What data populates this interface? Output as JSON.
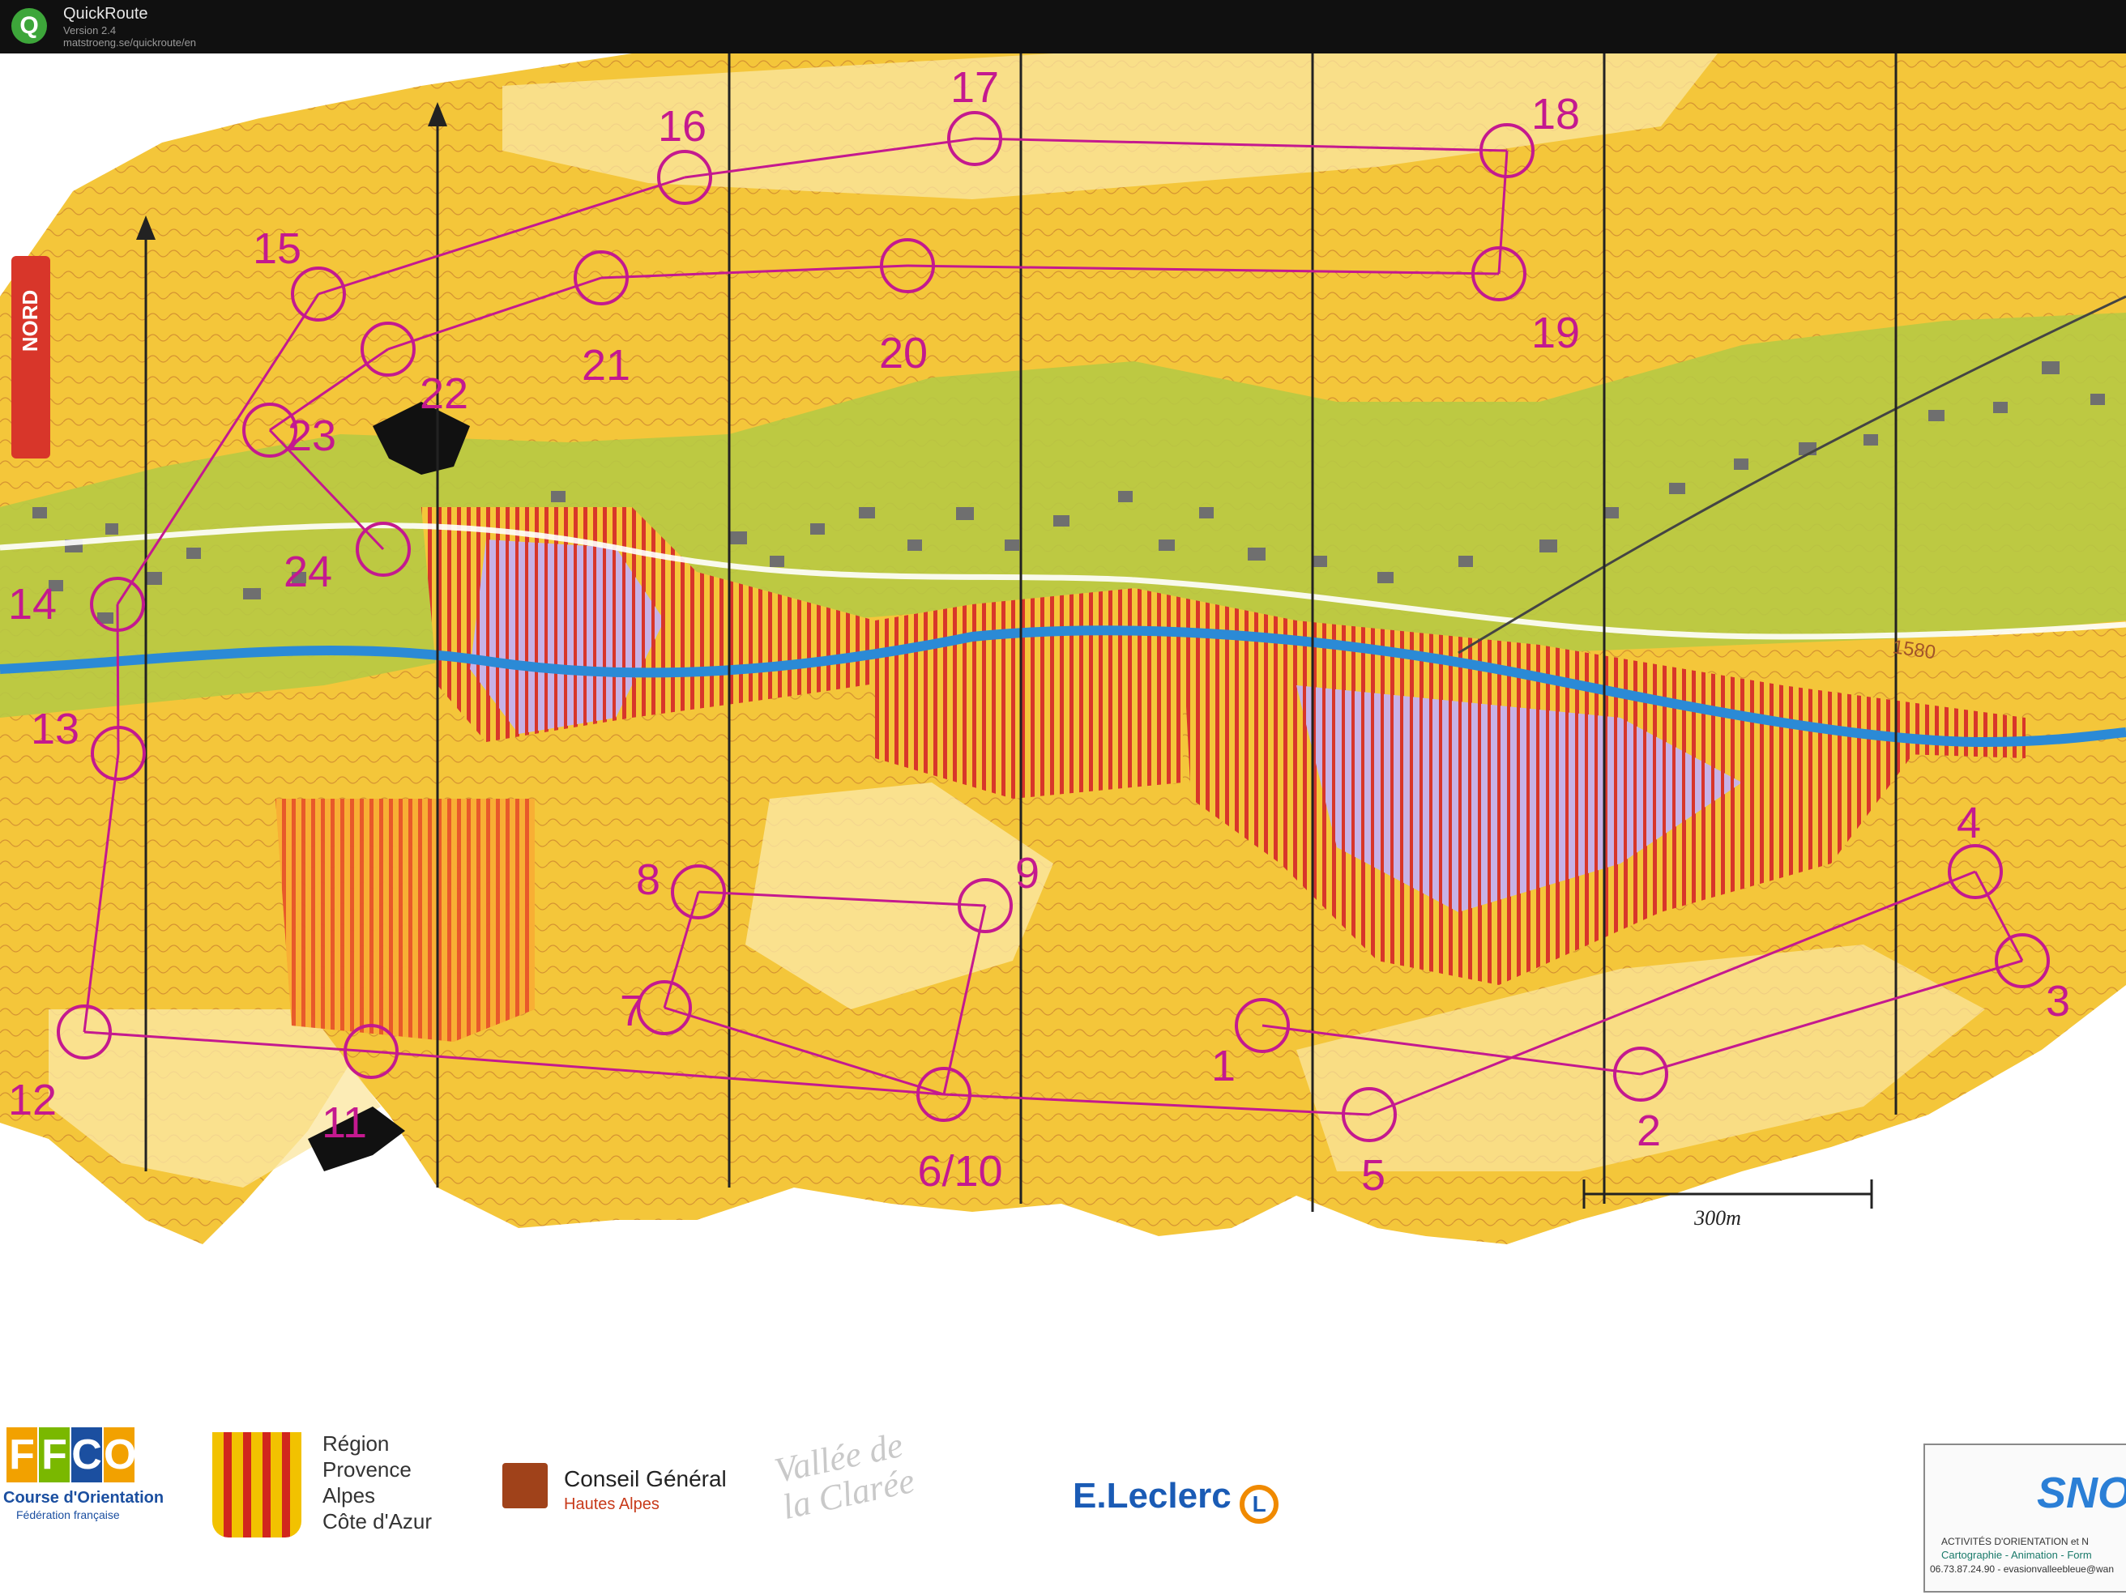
{
  "window": {
    "app_name": "QuickRoute",
    "app_icon": "Q",
    "version": "Version 2.4",
    "url": "matstroeng.se/quickroute/en"
  },
  "map": {
    "scale_label": "300m",
    "elevation_label": "1580",
    "north_label": "NORD",
    "colors": {
      "course": "#c4198f",
      "terrain_open": "#f4c63a",
      "terrain_light": "#fbe7a4",
      "forest_green": "#b7c944",
      "river": "#2b8ad6",
      "out_of_bounds": "#d8362a",
      "marsh": "#b69ad8"
    },
    "controls": [
      {
        "label": "1"
      },
      {
        "label": "2"
      },
      {
        "label": "3"
      },
      {
        "label": "4"
      },
      {
        "label": "5"
      },
      {
        "label": "6/10"
      },
      {
        "label": "7"
      },
      {
        "label": "8"
      },
      {
        "label": "9"
      },
      {
        "label": "11"
      },
      {
        "label": "12"
      },
      {
        "label": "13"
      },
      {
        "label": "14"
      },
      {
        "label": "15"
      },
      {
        "label": "16"
      },
      {
        "label": "17"
      },
      {
        "label": "18"
      },
      {
        "label": "19"
      },
      {
        "label": "20"
      },
      {
        "label": "21"
      },
      {
        "label": "22"
      },
      {
        "label": "23"
      },
      {
        "label": "24"
      }
    ]
  },
  "sponsors": {
    "ffco_letters": [
      "F",
      "F",
      "C",
      "O"
    ],
    "ffco_caption": "Course d'Orientation",
    "ffco_sub": "Fédération française",
    "region_text": "Région\nProvence\nAlpes\nCôte d'Azur",
    "cg_name": "Conseil Général",
    "cg_sub": "Hautes Alpes",
    "vallee_text": "Vallée de\nla Clarée",
    "leclerc": "E.Leclerc",
    "leclerc_mark": "L",
    "snoe_logo": "SNOE",
    "snoe_line1": "ACTIVITÉS D'ORIENTATION et N",
    "snoe_line2": "Cartographie - Animation - Form",
    "snoe_line3": "06.73.87.24.90 - evasionvalleebleue@wan"
  }
}
